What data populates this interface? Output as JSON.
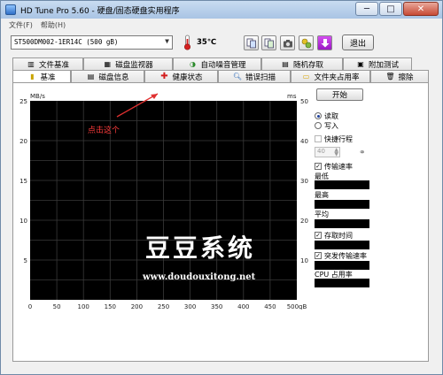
{
  "window": {
    "title": "HD Tune Pro 5.60 - 硬盘/固态硬盘实用程序",
    "buttons": {
      "minimize": "─",
      "maximize": "□",
      "close": "✕"
    }
  },
  "menu": {
    "file": "文件(F)",
    "help": "帮助(H)"
  },
  "toolbar": {
    "drive": "ST500DM002-1ER14C (500 gB)",
    "temperature": "35℃",
    "exit_label": "退出"
  },
  "tabs": {
    "top": [
      "文件基准",
      "磁盘监视器",
      "自动噪音管理",
      "随机存取",
      "附加测试"
    ],
    "bottom": [
      "基准",
      "磁盘信息",
      "健康状态",
      "错误扫描",
      "文件夹占用率",
      "擦除"
    ]
  },
  "controls": {
    "start_label": "开始",
    "read_label": "读取",
    "write_label": "写入",
    "short_stroke_label": "快捷行程",
    "short_stroke_value": "40",
    "transfer_rate_label": "传输速率",
    "min_label": "最低",
    "max_label": "最高",
    "avg_label": "平均",
    "access_time_label": "存取时间",
    "burst_rate_label": "突发传输速率",
    "cpu_label": "CPU 占用率"
  },
  "annotation": {
    "text": "点击这个"
  },
  "watermark": {
    "title": "豆豆系统",
    "url": "www.doudouxitong.net"
  },
  "chart_data": {
    "type": "line",
    "title": "",
    "left_unit": "MB/s",
    "right_unit": "ms",
    "x_ticks": [
      "0",
      "50",
      "100",
      "150",
      "200",
      "250",
      "300",
      "350",
      "400",
      "450",
      "500gB"
    ],
    "y_left_ticks": [
      "25",
      "20",
      "15",
      "10",
      "5"
    ],
    "y_right_ticks": [
      "50",
      "40",
      "30",
      "20",
      "10"
    ],
    "xlim": [
      0,
      500
    ],
    "ylim_left": [
      0,
      25
    ],
    "ylim_right": [
      0,
      50
    ],
    "grid": true,
    "series": []
  }
}
